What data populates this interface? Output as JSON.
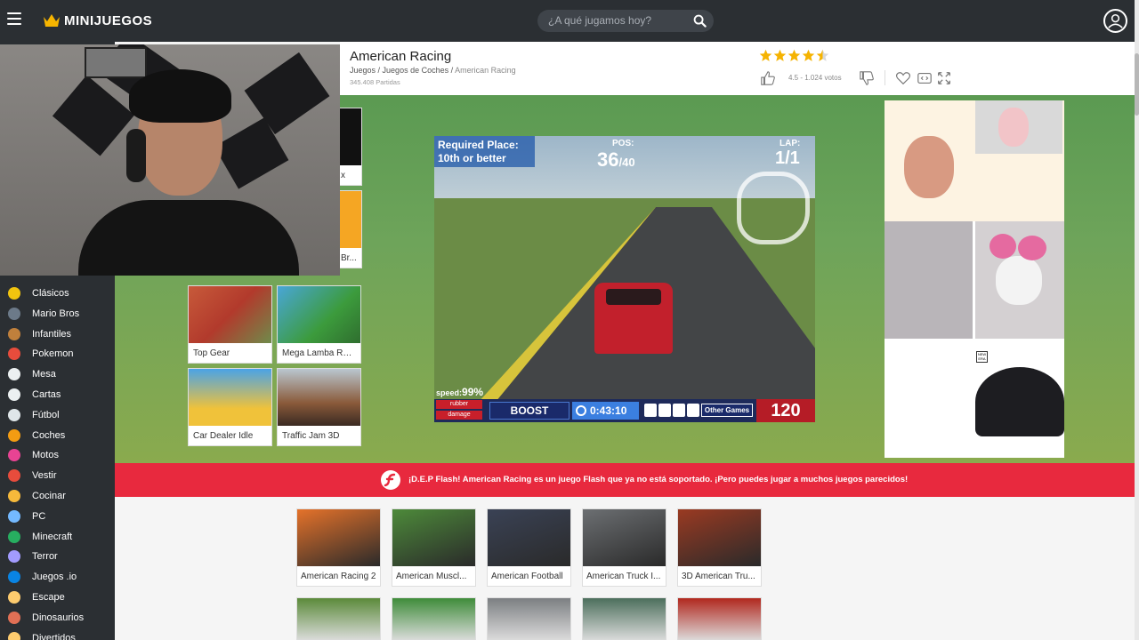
{
  "topbar": {
    "logo_text": "MINIJUEGOS",
    "search_placeholder": "¿A qué jugamos hoy?"
  },
  "sidebar": {
    "items": [
      {
        "label": "Clásicos",
        "color": "#f1c40f"
      },
      {
        "label": "Mario Bros",
        "color": "#6c7a89"
      },
      {
        "label": "Infantiles",
        "color": "#c0803c"
      },
      {
        "label": "Pokemon",
        "color": "#e74c3c"
      },
      {
        "label": "Mesa",
        "color": "#ecf0f1"
      },
      {
        "label": "Cartas",
        "color": "#ecf0f1"
      },
      {
        "label": "Fútbol",
        "color": "#dfe6e9"
      },
      {
        "label": "Coches",
        "color": "#f39c12"
      },
      {
        "label": "Motos",
        "color": "#e84393"
      },
      {
        "label": "Vestir",
        "color": "#e74c3c"
      },
      {
        "label": "Cocinar",
        "color": "#f6b93b"
      },
      {
        "label": "PC",
        "color": "#74b9ff"
      },
      {
        "label": "Minecraft",
        "color": "#27ae60"
      },
      {
        "label": "Terror",
        "color": "#a29bfe"
      },
      {
        "label": "Juegos .io",
        "color": "#0984e3"
      },
      {
        "label": "Escape",
        "color": "#fdcb6e"
      },
      {
        "label": "Dinosaurios",
        "color": "#e17055"
      },
      {
        "label": "Divertidos",
        "color": "#fdcb6e"
      }
    ]
  },
  "header": {
    "title": "American Racing",
    "breadcrumb": [
      "Juegos",
      "Juegos de Coches",
      "American Racing"
    ],
    "breadcrumb_sep": " / ",
    "plays": "345.408 Partidas",
    "rating": 4.5,
    "votes": "4.5 - 1.024 votos"
  },
  "related_left": [
    {
      "label": "x",
      "color": "#222"
    },
    {
      "label": "Br...",
      "color": "#f5a623"
    },
    {
      "label": "Top Gear",
      "color": "#b23a2c"
    },
    {
      "label": "Mega Lamba Ra...",
      "color": "#3c9b3c"
    },
    {
      "label": "Car Dealer Idle",
      "color": "#2d7fd1"
    },
    {
      "label": "Traffic Jam 3D",
      "color": "#8a5a3a"
    }
  ],
  "game_hud": {
    "req_line1": "Required Place:",
    "req_line2": "10th or better",
    "pos_label": "POS:",
    "pos_value": "36",
    "pos_total": "/40",
    "lap_label": "LAP:",
    "lap_value": "1/1",
    "speed_label": "speed:",
    "speed_value": "99%",
    "rubber": "rubber",
    "damage": "damage",
    "boost": "BOOST",
    "timer": "0:43:10",
    "other_games": "Other Games",
    "speedometer": "120"
  },
  "ad": {
    "badge": "NEW ERA"
  },
  "flash_banner": {
    "text": "¡D.E.P Flash! American Racing es un juego Flash que ya no está soportado. ¡Pero puedes jugar a muchos juegos parecidos!"
  },
  "similar_games": [
    {
      "label": "American Racing 2",
      "color": "#e5722a"
    },
    {
      "label": "American Muscl...",
      "color": "#4d8a3a"
    },
    {
      "label": "American Football",
      "color": "#3a4255"
    },
    {
      "label": "American Truck I...",
      "color": "#6c6f72"
    },
    {
      "label": "3D American Tru...",
      "color": "#9a3a22"
    }
  ],
  "similar_games_row2": [
    {
      "color": "#5b8a3a"
    },
    {
      "color": "#3f8c3a"
    },
    {
      "color": "#7c7f82"
    },
    {
      "color": "#4c6f5c"
    },
    {
      "color": "#b1281e"
    }
  ]
}
